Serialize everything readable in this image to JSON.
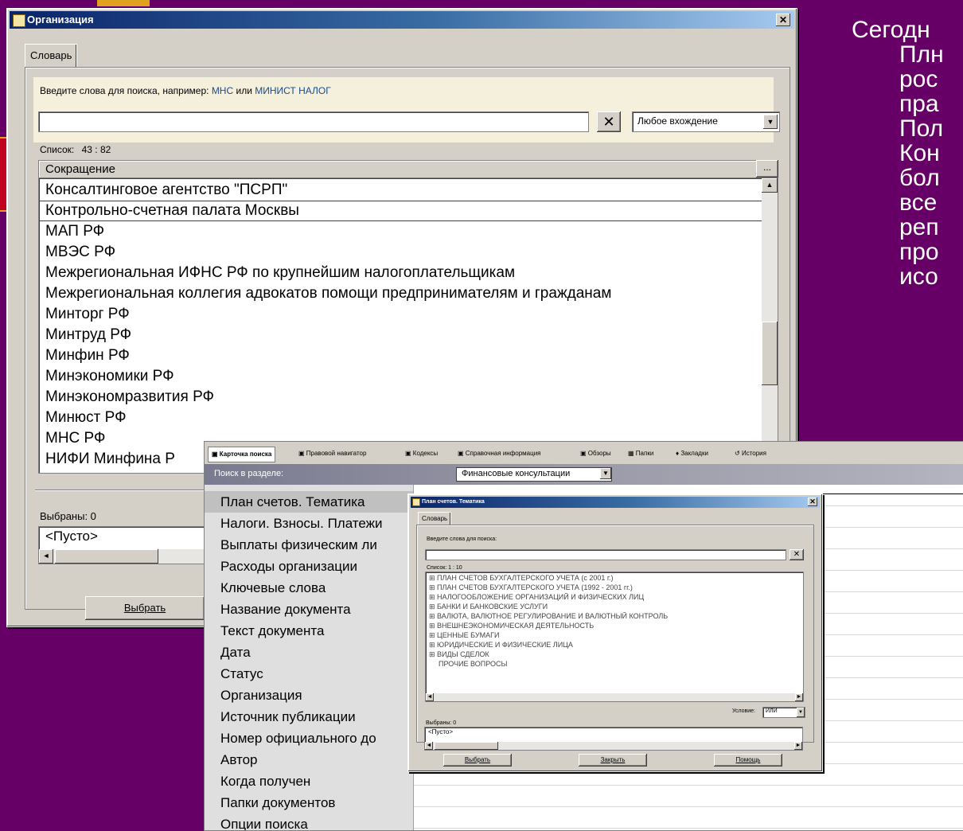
{
  "slide": {
    "lines": [
      "Сегодн",
      "Плн",
      "рос",
      "пра",
      "Пол",
      "Кон",
      "бол",
      "все",
      "реп",
      "про",
      "исо"
    ]
  },
  "org_dialog": {
    "title": "Организация",
    "tab": "Словарь",
    "hint_prefix": "Введите слова для поиска, например:",
    "hint_ex1": "МНС",
    "hint_or": "или",
    "hint_ex2": "МИНИСТ НАЛОГ",
    "search_value": "",
    "match_mode": "Любое вхождение",
    "list_count_label": "Список:",
    "list_count": "43 : 82",
    "column_header": "Сокращение",
    "column_more": "...",
    "items": [
      "Консалтинговое агентство \"ПСРП\"",
      "Контрольно-счетная палата Москвы",
      "МАП РФ",
      "МВЭС РФ",
      "Межрегиональная ИФНС РФ по крупнейшим налогоплательщикам",
      "Межрегиональная коллегия адвокатов помощи предпринимателям и гражданам",
      "Минторг РФ",
      "Минтруд РФ",
      "Минфин РФ",
      "Минэкономики РФ",
      "Минэкономразвития РФ",
      "Минюст РФ",
      "МНС РФ",
      "НИФИ Минфина Р"
    ],
    "selected_label": "Выбраны: 0",
    "selected_value": "<Пусто>",
    "choose_button": "Выбрать"
  },
  "main_app": {
    "tabs": [
      "Карточка поиска",
      "Правовой навигатор",
      "Кодексы",
      "Справочная информация",
      "Обзоры",
      "Папки",
      "Закладки",
      "История"
    ],
    "section_label": "Поиск в разделе:",
    "section_value": "Финансовые консультации",
    "fields": [
      "План счетов. Тематика",
      "Налоги. Взносы. Платежи",
      "Выплаты физическим ли",
      "Расходы организации",
      "Ключевые слова",
      "Название документа",
      "Текст документа",
      "Дата",
      "Статус",
      "Организация",
      "Источник публикации",
      "Номер официального до",
      "Автор",
      "Когда получен",
      "Папки документов",
      "Опции поиска"
    ]
  },
  "plan_dialog": {
    "title": "План счетов. Тематика",
    "tab": "Словарь",
    "hint": "Введите слова для поиска:",
    "list_count": "Список: 1 : 10",
    "items": [
      "ПЛАН СЧЕТОВ БУХГАЛТЕРСКОГО УЧЕТА (с 2001 г.)",
      "ПЛАН СЧЕТОВ БУХГАЛТЕРСКОГО УЧЕТА (1992 - 2001 гг.)",
      "НАЛОГООБЛОЖЕНИЕ ОРГАНИЗАЦИЙ И ФИЗИЧЕСКИХ ЛИЦ",
      "БАНКИ И БАНКОВСКИЕ УСЛУГИ",
      "ВАЛЮТА, ВАЛЮТНОЕ РЕГУЛИРОВАНИЕ И ВАЛЮТНЫЙ КОНТРОЛЬ",
      "ВНЕШНЕЭКОНОМИЧЕСКАЯ ДЕЯТЕЛЬНОСТЬ",
      "ЦЕННЫЕ БУМАГИ",
      "ЮРИДИЧЕСКИЕ И ФИЗИЧЕСКИЕ ЛИЦА",
      "ВИДЫ СДЕЛОК",
      "ПРОЧИЕ ВОПРОСЫ"
    ],
    "condition_label": "Условие:",
    "condition_value": "ИЛИ",
    "selected_label": "Выбраны: 0",
    "selected_value": "<Пусто>",
    "buttons": [
      "Выбрать",
      "Закрыть",
      "Помощь"
    ]
  }
}
